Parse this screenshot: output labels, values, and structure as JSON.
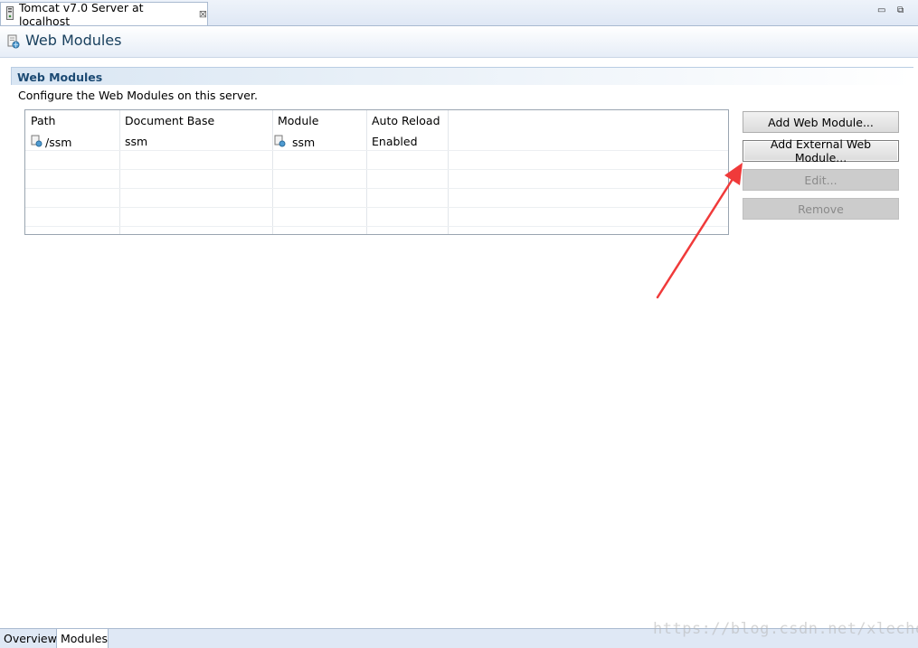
{
  "editor_tab": {
    "title": "Tomcat v7.0 Server at localhost",
    "close_glyph": "⊠"
  },
  "window_controls": {
    "minimize": "▭",
    "restore": "⧉"
  },
  "page": {
    "title": "Web Modules"
  },
  "section": {
    "title": "Web Modules",
    "description": "Configure the Web Modules on this server."
  },
  "table": {
    "columns": [
      "Path",
      "Document Base",
      "Module",
      "Auto Reload"
    ],
    "rows": [
      {
        "path": "/ssm",
        "document_base": "ssm",
        "module": "ssm",
        "auto_reload": "Enabled"
      }
    ]
  },
  "buttons": {
    "add_web_module": "Add Web Module...",
    "add_external_web_module": "Add External Web Module...",
    "edit": "Edit...",
    "remove": "Remove"
  },
  "bottom_tabs": [
    "Overview",
    "Modules"
  ],
  "active_bottom_tab": "Modules",
  "watermark": "https://blog.csdn.net/xlecho",
  "colors": {
    "accent": "#19405e",
    "annotation_arrow": "#f03a3a"
  },
  "icons": {
    "server": "server-icon",
    "module": "web-module-icon"
  }
}
